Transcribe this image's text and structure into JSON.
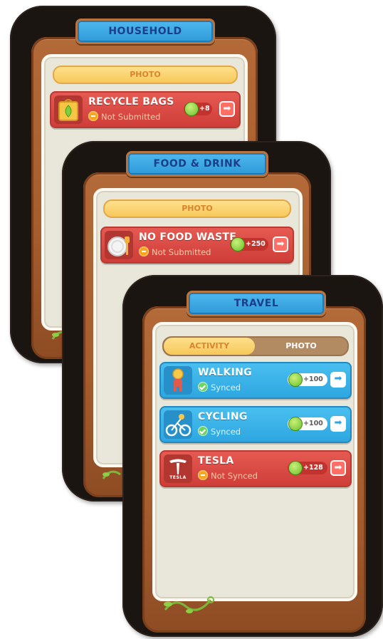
{
  "cards": [
    {
      "title": "HOUSEHOLD",
      "tab_label": "PHOTO",
      "items": [
        {
          "title": "RECYCLE BAGS",
          "status": "Not Submitted",
          "points": "+8",
          "icon": "recycle-bag-icon"
        }
      ]
    },
    {
      "title": "FOOD & DRINK",
      "tab_label": "PHOTO",
      "items": [
        {
          "title": "NO FOOD WASTE",
          "status": "Not Submitted",
          "points": "+250",
          "icon": "plate-cutlery-icon"
        }
      ]
    },
    {
      "title": "TRAVEL",
      "tabs": [
        "ACTIVITY",
        "PHOTO"
      ],
      "items": [
        {
          "title": "WALKING",
          "status": "Synced",
          "points": "+100",
          "icon": "walking-person-icon"
        },
        {
          "title": "CYCLING",
          "status": "Synced",
          "points": "+100",
          "icon": "cyclist-icon"
        },
        {
          "title": "TESLA",
          "status": "Not Synced",
          "points": "+128",
          "icon": "tesla-logo-icon",
          "logo_text": "TESLA"
        }
      ]
    }
  ],
  "colors": {
    "red_row": "#cf3d38",
    "blue_row": "#2ea6e0",
    "banner": "#2d9ad8",
    "coin": "#6bbf29"
  }
}
